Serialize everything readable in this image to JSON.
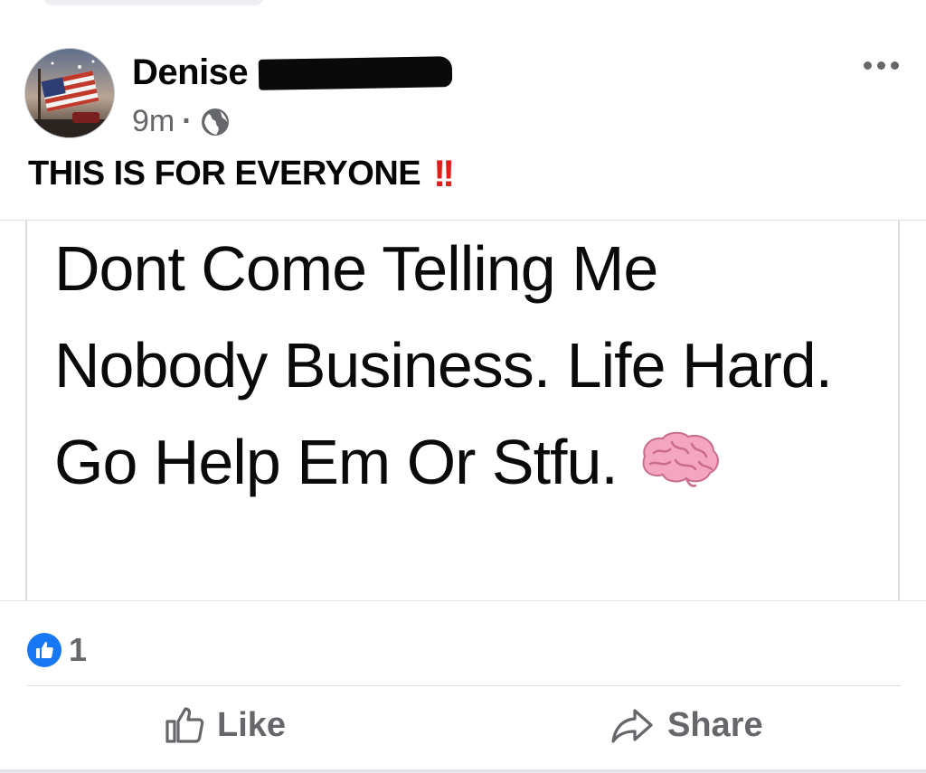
{
  "post": {
    "author_name": "Denise",
    "timestamp": "9m",
    "separator": "·",
    "audience_icon": "globe-icon",
    "caption_text": "THIS IS FOR EVERYONE",
    "caption_emoji": "!!",
    "image_text": "Dont Come Telling Me Nobody Business. Life Hard. Go Help Em Or Stfu.",
    "image_emoji": "brain-emoji"
  },
  "reactions": {
    "icon": "thumbs-up-badge-icon",
    "count": "1"
  },
  "actions": {
    "like_label": "Like",
    "share_label": "Share"
  },
  "colors": {
    "brand_blue": "#1877f2",
    "secondary_text": "#65676b",
    "alert_red": "#e0201a"
  }
}
